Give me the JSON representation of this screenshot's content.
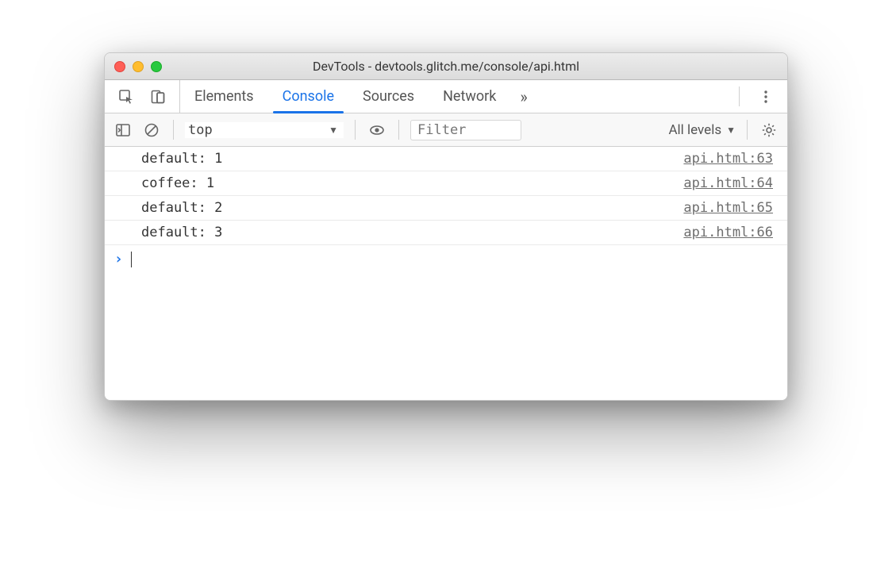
{
  "window": {
    "title": "DevTools - devtools.glitch.me/console/api.html"
  },
  "tabs": {
    "items": [
      "Elements",
      "Console",
      "Sources",
      "Network"
    ],
    "active_index": 1,
    "more_glyph": "»"
  },
  "console_toolbar": {
    "context_value": "top",
    "filter_placeholder": "Filter",
    "levels_label": "All levels"
  },
  "console": {
    "rows": [
      {
        "message": "default: 1",
        "source": "api.html:63"
      },
      {
        "message": "coffee: 1",
        "source": "api.html:64"
      },
      {
        "message": "default: 2",
        "source": "api.html:65"
      },
      {
        "message": "default: 3",
        "source": "api.html:66"
      }
    ]
  }
}
